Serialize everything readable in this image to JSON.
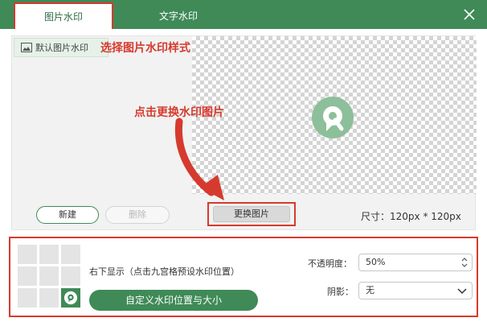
{
  "tabs": {
    "image": "图片水印",
    "text": "文字水印"
  },
  "top_panel": {
    "default_label": "默认图片水印",
    "annotation_select": "选择图片水印样式",
    "annotation_change": "点击更换水印图片",
    "new_button": "新建",
    "delete_button": "删除",
    "change_button": "更换图片",
    "size_text": "尺寸：120px * 120px"
  },
  "bottom_panel": {
    "position_text": "右下显示（点击九宫格预设水印位置）",
    "custom_button": "自定义水印位置与大小",
    "opacity_label": "不透明度：",
    "opacity_value": "50%",
    "shadow_label": "阴影：",
    "shadow_value": "无"
  },
  "colors": {
    "brand_green": "#3f8a57",
    "annotation_red": "#d63a2e"
  },
  "icons": [
    "close-icon",
    "picture-icon",
    "watermark-logo-icon",
    "spinner-icon",
    "chevron-down-icon"
  ]
}
